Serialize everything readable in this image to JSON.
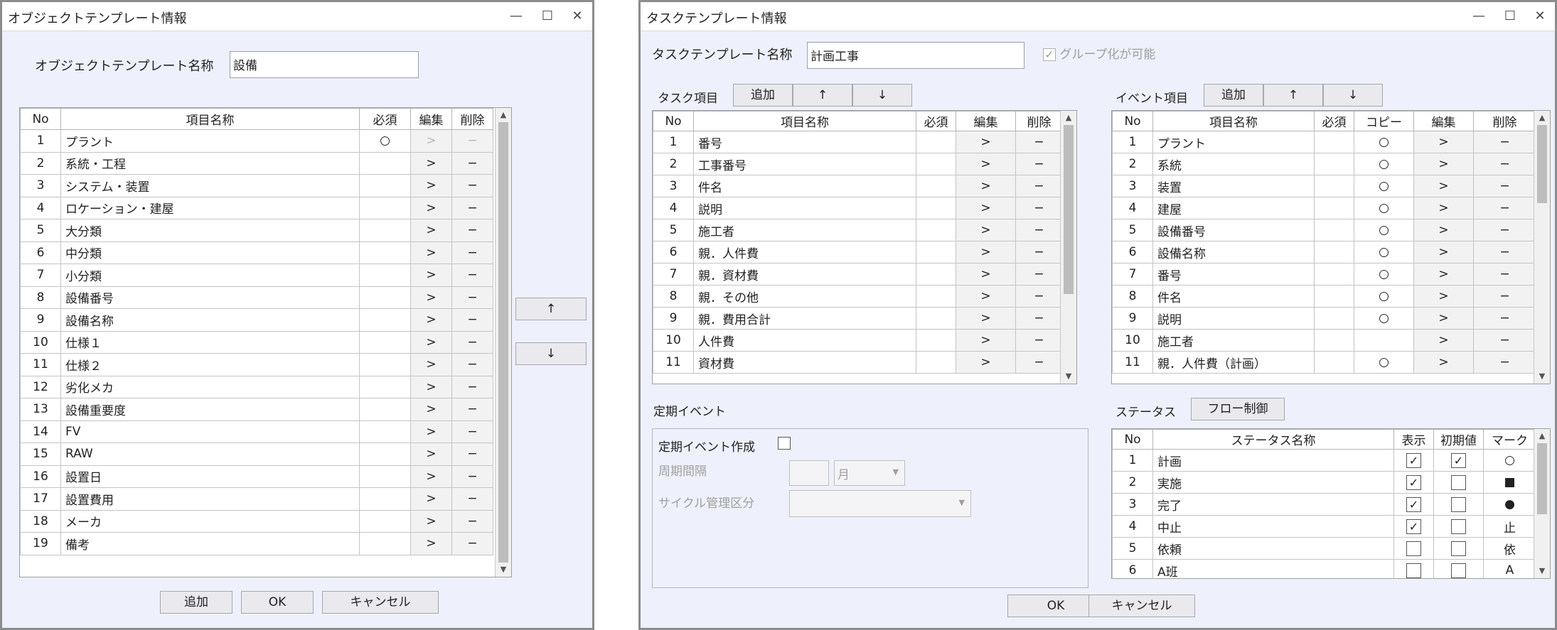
{
  "left": {
    "title": "オブジェクトテンプレート情報",
    "name_label": "オブジェクトテンプレート名称",
    "name_value": "設備",
    "table": {
      "headers": [
        "No",
        "項目名称",
        "必須",
        "編集",
        "削除"
      ],
      "rows": [
        [
          "1",
          "プラント",
          "○",
          ">",
          "−"
        ],
        [
          "2",
          "系統・工程",
          "",
          ">",
          "−"
        ],
        [
          "3",
          "システム・装置",
          "",
          ">",
          "−"
        ],
        [
          "4",
          "ロケーション・建屋",
          "",
          ">",
          "−"
        ],
        [
          "5",
          "大分類",
          "",
          ">",
          "−"
        ],
        [
          "6",
          "中分類",
          "",
          ">",
          "−"
        ],
        [
          "7",
          "小分類",
          "",
          ">",
          "−"
        ],
        [
          "8",
          "設備番号",
          "",
          ">",
          "−"
        ],
        [
          "9",
          "設備名称",
          "",
          ">",
          "−"
        ],
        [
          "10",
          "仕様１",
          "",
          ">",
          "−"
        ],
        [
          "11",
          "仕様２",
          "",
          ">",
          "−"
        ],
        [
          "12",
          "劣化メカ",
          "",
          ">",
          "−"
        ],
        [
          "13",
          "設備重要度",
          "",
          ">",
          "−"
        ],
        [
          "14",
          "FV",
          "",
          ">",
          "−"
        ],
        [
          "15",
          "RAW",
          "",
          ">",
          "−"
        ],
        [
          "16",
          "設置日",
          "",
          ">",
          "−"
        ],
        [
          "17",
          "設置費用",
          "",
          ">",
          "−"
        ],
        [
          "18",
          "メーカ",
          "",
          ">",
          "−"
        ],
        [
          "19",
          "備考",
          "",
          ">",
          "−"
        ]
      ]
    },
    "up_label": "↑",
    "down_label": "↓",
    "add_label": "追加",
    "ok_label": "OK",
    "cancel_label": "キャンセル"
  },
  "right": {
    "title": "タスクテンプレート情報",
    "name_label": "タスクテンプレート名称",
    "name_value": "計画工事",
    "group_label": "グループ化が可能",
    "task": {
      "label": "タスク項目",
      "add_label": "追加",
      "up_label": "↑",
      "down_label": "↓",
      "headers": [
        "No",
        "項目名称",
        "必須",
        "編集",
        "削除"
      ],
      "rows": [
        [
          "1",
          "番号",
          "",
          ">",
          "−"
        ],
        [
          "2",
          "工事番号",
          "",
          ">",
          "−"
        ],
        [
          "3",
          "件名",
          "",
          ">",
          "−"
        ],
        [
          "4",
          "説明",
          "",
          ">",
          "−"
        ],
        [
          "5",
          "施工者",
          "",
          ">",
          "−"
        ],
        [
          "6",
          "親．人件費",
          "",
          ">",
          "−"
        ],
        [
          "7",
          "親．資材費",
          "",
          ">",
          "−"
        ],
        [
          "8",
          "親．その他",
          "",
          ">",
          "−"
        ],
        [
          "9",
          "親．費用合計",
          "",
          ">",
          "−"
        ],
        [
          "10",
          "人件費",
          "",
          ">",
          "−"
        ],
        [
          "11",
          "資材費",
          "",
          ">",
          "−"
        ]
      ]
    },
    "event": {
      "label": "イベント項目",
      "add_label": "追加",
      "up_label": "↑",
      "down_label": "↓",
      "headers": [
        "No",
        "項目名称",
        "必須",
        "コピー",
        "編集",
        "削除"
      ],
      "rows": [
        [
          "1",
          "プラント",
          "",
          "○",
          ">",
          "−"
        ],
        [
          "2",
          "系統",
          "",
          "○",
          ">",
          "−"
        ],
        [
          "3",
          "装置",
          "",
          "○",
          ">",
          "−"
        ],
        [
          "4",
          "建屋",
          "",
          "○",
          ">",
          "−"
        ],
        [
          "5",
          "設備番号",
          "",
          "○",
          ">",
          "−"
        ],
        [
          "6",
          "設備名称",
          "",
          "○",
          ">",
          "−"
        ],
        [
          "7",
          "番号",
          "",
          "○",
          ">",
          "−"
        ],
        [
          "8",
          "件名",
          "",
          "○",
          ">",
          "−"
        ],
        [
          "9",
          "説明",
          "",
          "○",
          ">",
          "−"
        ],
        [
          "10",
          "施工者",
          "",
          "",
          ">",
          "−"
        ],
        [
          "11",
          "親．人件費（計画）",
          "",
          "○",
          ">",
          "−"
        ]
      ]
    },
    "periodic": {
      "label": "定期イベント",
      "create_label": "定期イベント作成",
      "interval_label": "周期間隔",
      "interval_unit": "月",
      "cycle_label": "サイクル管理区分"
    },
    "status": {
      "label": "ステータス",
      "flow_label": "フロー制御",
      "headers": [
        "No",
        "ステータス名称",
        "表示",
        "初期値",
        "マーク"
      ],
      "rows": [
        {
          "no": "1",
          "name": "計画",
          "show": true,
          "init": true,
          "mark": "○"
        },
        {
          "no": "2",
          "name": "実施",
          "show": true,
          "init": false,
          "mark": "■"
        },
        {
          "no": "3",
          "name": "完了",
          "show": true,
          "init": false,
          "mark": "●"
        },
        {
          "no": "4",
          "name": "中止",
          "show": true,
          "init": false,
          "mark": "止"
        },
        {
          "no": "5",
          "name": "依頼",
          "show": false,
          "init": false,
          "mark": "依"
        },
        {
          "no": "6",
          "name": "A班",
          "show": false,
          "init": false,
          "mark": "A"
        }
      ]
    },
    "ok_label": "OK",
    "cancel_label": "キャンセル"
  }
}
